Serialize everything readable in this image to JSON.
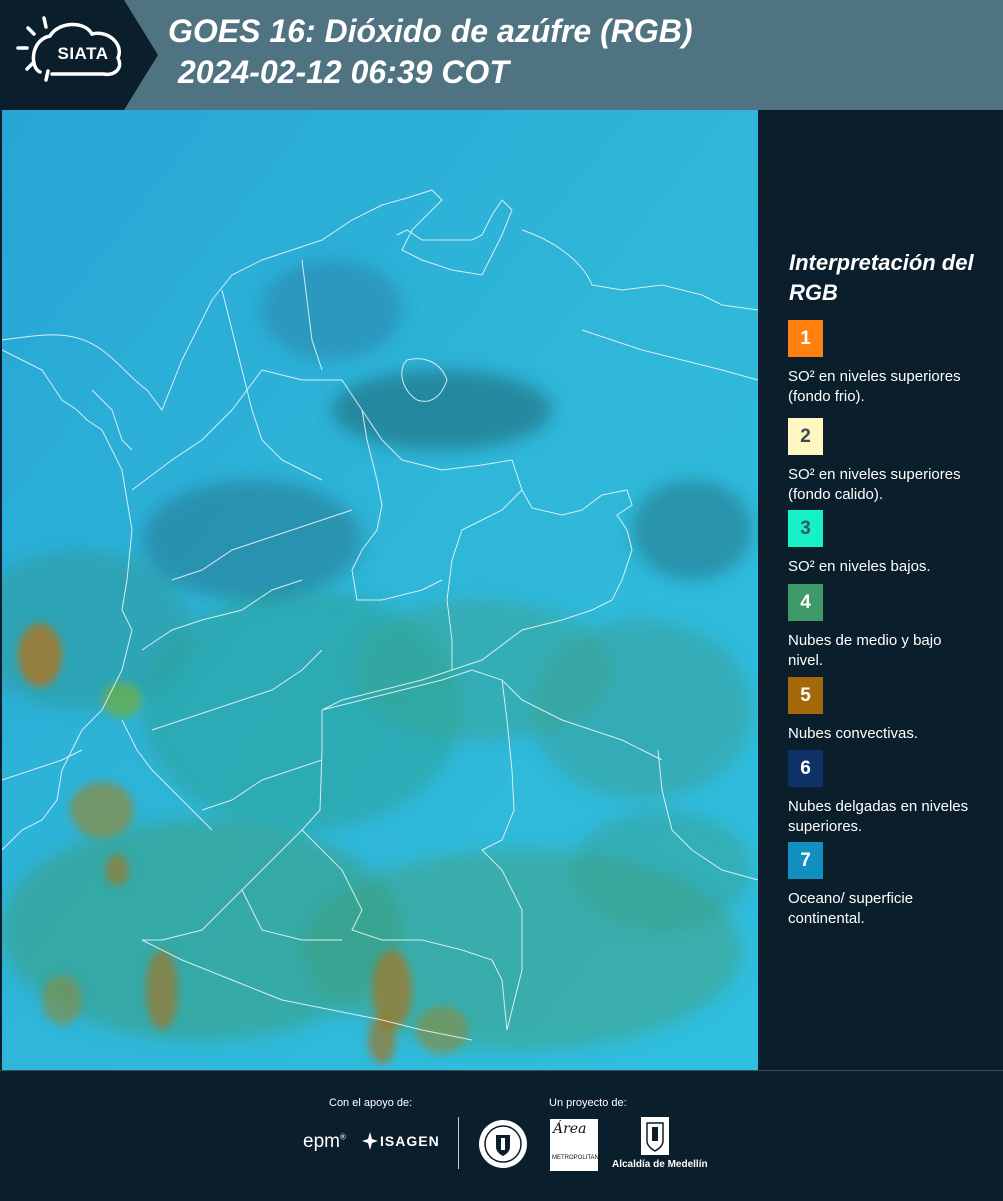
{
  "header": {
    "logo_text": "SIATA",
    "title": "GOES 16: Dióxido de azúfre (RGB)",
    "timestamp": "2024-02-12 06:39 COT"
  },
  "legend": {
    "title": "Interpretación del RGB",
    "items": [
      {
        "num": "1",
        "color": "#ff7f0f",
        "text_color": "#ffffff",
        "label": "SO² en niveles superiores (fondo frio)."
      },
      {
        "num": "2",
        "color": "#fff6c2",
        "text_color": "#3a4a55",
        "label": "SO² en niveles superiores (fondo calido)."
      },
      {
        "num": "3",
        "color": "#18f0c8",
        "text_color": "#2c5a66",
        "label": "SO² en niveles bajos."
      },
      {
        "num": "4",
        "color": "#3f9a6a",
        "text_color": "#ffffff",
        "label": "Nubes de medio y bajo nivel."
      },
      {
        "num": "5",
        "color": "#a3680a",
        "text_color": "#ffffff",
        "label": "Nubes convectivas."
      },
      {
        "num": "6",
        "color": "#0f3266",
        "text_color": "#ffffff",
        "label": "Nubes delgadas en niveles superiores."
      },
      {
        "num": "7",
        "color": "#118fc0",
        "text_color": "#ffffff",
        "label": "Oceano/ superficie continental."
      }
    ]
  },
  "footer": {
    "support_caption": "Con el apoyo de:",
    "project_caption": "Un proyecto de:",
    "epm": "epm",
    "isagen": "ISAGEN",
    "area_script": "Área",
    "area_sub": "METROPOLITANA",
    "alcaldia": "Alcaldía de Medellín"
  }
}
